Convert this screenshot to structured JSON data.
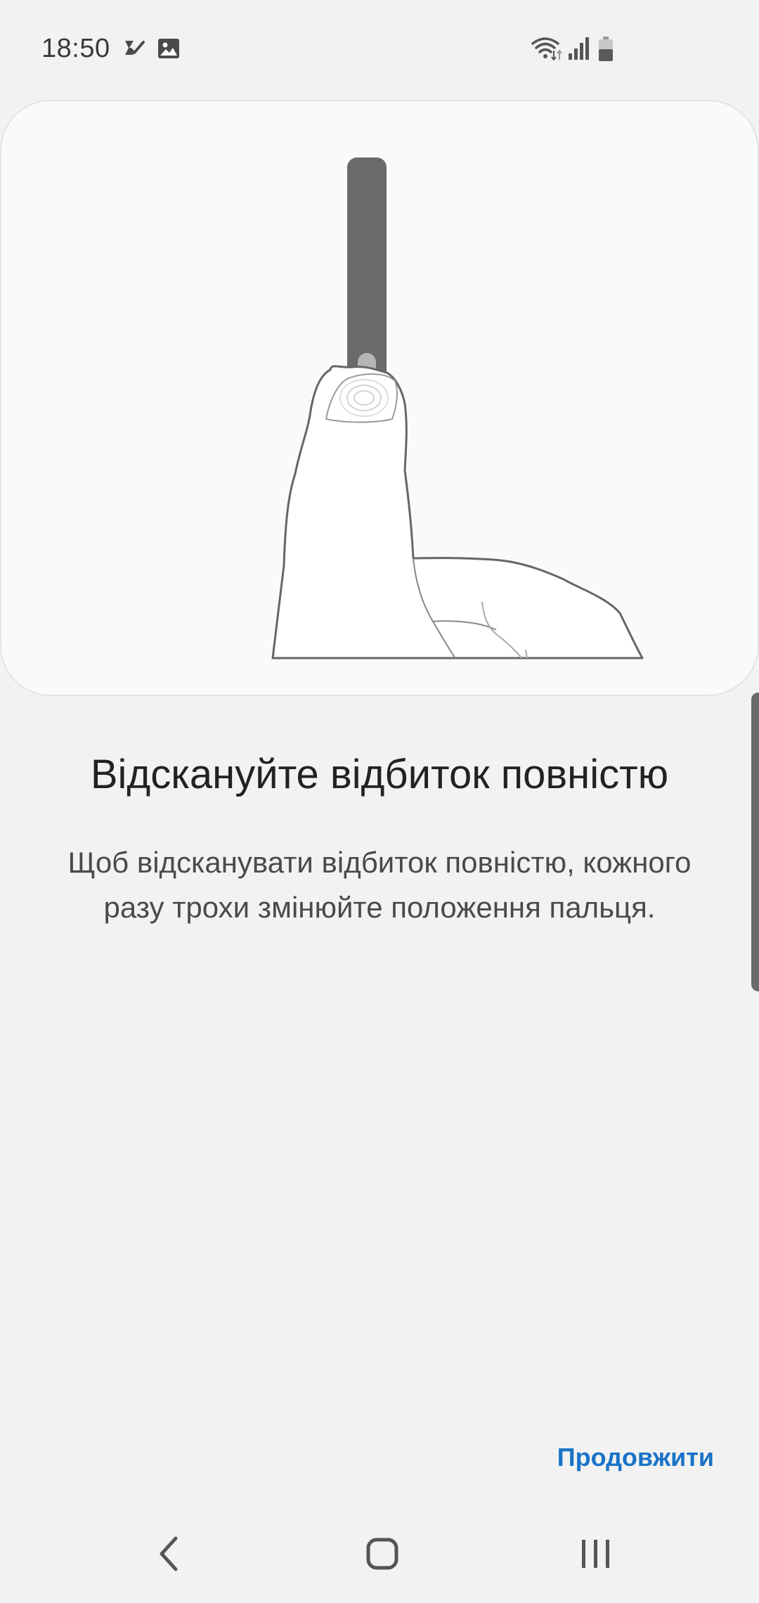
{
  "status_bar": {
    "time": "18:50",
    "icons": [
      "notification-check-icon",
      "image-icon",
      "wifi-icon",
      "signal-icon",
      "battery-icon"
    ]
  },
  "illustration": {
    "icon": "finger-on-fingerprint-sensor-illustration"
  },
  "main": {
    "title": "Відскануйте відбиток повністю",
    "description": "Щоб відсканувати відбиток повністю, кожного разу трохи змінюйте положення пальця."
  },
  "actions": {
    "continue_label": "Продовжити"
  },
  "navigation": {
    "items": [
      "back",
      "home",
      "recents"
    ]
  },
  "colors": {
    "accent": "#1a73c7",
    "background": "#f2f2f2",
    "card": "#fafafa"
  }
}
